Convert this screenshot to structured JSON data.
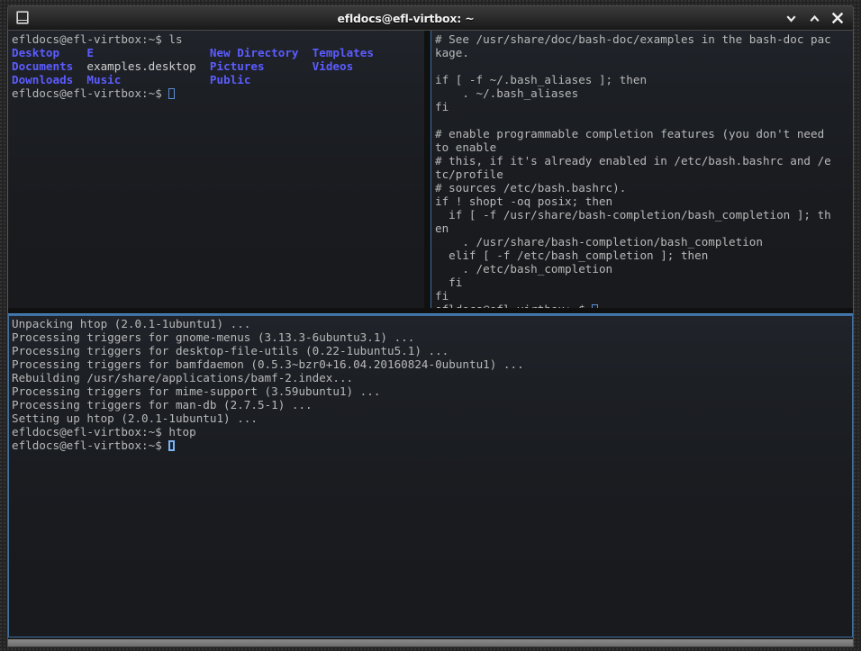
{
  "window": {
    "title": "efldocs@efl-virtbox: ~",
    "icon": "terminal-window-icon",
    "controls": [
      {
        "name": "minimize-button",
        "glyph": "chevron-down"
      },
      {
        "name": "maximize-button",
        "glyph": "chevron-up"
      },
      {
        "name": "close-button",
        "glyph": "cross"
      }
    ]
  },
  "colors": {
    "directory_blue": "#5c5cff",
    "foreground": "#c8c8c8",
    "background": "#1a1c20",
    "active_border": "#3f6f9f",
    "cursor": "#7fb4f0"
  },
  "panes": {
    "top_left": {
      "name": "pane-top-left",
      "active": false,
      "lines": [
        [
          {
            "t": "efldocs@efl-virtbox:~$ ls",
            "c": "dim"
          }
        ],
        [
          {
            "t": "Desktop",
            "c": "blue"
          },
          {
            "t": "    ",
            "c": "dim"
          },
          {
            "t": "E",
            "c": "blue"
          },
          {
            "t": "                 ",
            "c": "dim"
          },
          {
            "t": "New Directory",
            "c": "blue"
          },
          {
            "t": "  ",
            "c": "dim"
          },
          {
            "t": "Templates",
            "c": "blue"
          }
        ],
        [
          {
            "t": "Documents",
            "c": "blue"
          },
          {
            "t": "  ",
            "c": "dim"
          },
          {
            "t": "examples.desktop",
            "c": "white"
          },
          {
            "t": "  ",
            "c": "dim"
          },
          {
            "t": "Pictures",
            "c": "blue"
          },
          {
            "t": "       ",
            "c": "dim"
          },
          {
            "t": "Videos",
            "c": "blue"
          }
        ],
        [
          {
            "t": "Downloads",
            "c": "blue"
          },
          {
            "t": "  ",
            "c": "dim"
          },
          {
            "t": "Music",
            "c": "blue"
          },
          {
            "t": "             ",
            "c": "dim"
          },
          {
            "t": "Public",
            "c": "blue"
          }
        ],
        [
          {
            "t": "efldocs@efl-virtbox:~$ ",
            "c": "dim"
          },
          {
            "t": "",
            "c": "cursor-hollow"
          }
        ]
      ]
    },
    "top_right": {
      "name": "pane-top-right",
      "active": false,
      "lines": [
        [
          {
            "t": "# See /usr/share/doc/bash-doc/examples in the bash-doc pac",
            "c": "dim"
          }
        ],
        [
          {
            "t": "kage.",
            "c": "dim"
          }
        ],
        [
          {
            "t": "",
            "c": "dim"
          }
        ],
        [
          {
            "t": "if [ -f ~/.bash_aliases ]; then",
            "c": "dim"
          }
        ],
        [
          {
            "t": "    . ~/.bash_aliases",
            "c": "dim"
          }
        ],
        [
          {
            "t": "fi",
            "c": "dim"
          }
        ],
        [
          {
            "t": "",
            "c": "dim"
          }
        ],
        [
          {
            "t": "# enable programmable completion features (you don't need",
            "c": "dim"
          }
        ],
        [
          {
            "t": "to enable",
            "c": "dim"
          }
        ],
        [
          {
            "t": "# this, if it's already enabled in /etc/bash.bashrc and /e",
            "c": "dim"
          }
        ],
        [
          {
            "t": "tc/profile",
            "c": "dim"
          }
        ],
        [
          {
            "t": "# sources /etc/bash.bashrc).",
            "c": "dim"
          }
        ],
        [
          {
            "t": "if ! shopt -oq posix; then",
            "c": "dim"
          }
        ],
        [
          {
            "t": "  if [ -f /usr/share/bash-completion/bash_completion ]; th",
            "c": "dim"
          }
        ],
        [
          {
            "t": "en",
            "c": "dim"
          }
        ],
        [
          {
            "t": "    . /usr/share/bash-completion/bash_completion",
            "c": "dim"
          }
        ],
        [
          {
            "t": "  elif [ -f /etc/bash_completion ]; then",
            "c": "dim"
          }
        ],
        [
          {
            "t": "    . /etc/bash_completion",
            "c": "dim"
          }
        ],
        [
          {
            "t": "  fi",
            "c": "dim"
          }
        ],
        [
          {
            "t": "fi",
            "c": "dim"
          }
        ],
        [
          {
            "t": "efldocs@efl-virtbox:~$ ",
            "c": "dim"
          },
          {
            "t": "",
            "c": "cursor-hollow"
          }
        ]
      ]
    },
    "bottom": {
      "name": "pane-bottom",
      "active": true,
      "lines": [
        [
          {
            "t": "Unpacking htop (2.0.1-1ubuntu1) ...",
            "c": "dim"
          }
        ],
        [
          {
            "t": "Processing triggers for gnome-menus (3.13.3-6ubuntu3.1) ...",
            "c": "dim"
          }
        ],
        [
          {
            "t": "Processing triggers for desktop-file-utils (0.22-1ubuntu5.1) ...",
            "c": "dim"
          }
        ],
        [
          {
            "t": "Processing triggers for bamfdaemon (0.5.3~bzr0+16.04.20160824-0ubuntu1) ...",
            "c": "dim"
          }
        ],
        [
          {
            "t": "Rebuilding /usr/share/applications/bamf-2.index...",
            "c": "dim"
          }
        ],
        [
          {
            "t": "Processing triggers for mime-support (3.59ubuntu1) ...",
            "c": "dim"
          }
        ],
        [
          {
            "t": "Processing triggers for man-db (2.7.5-1) ...",
            "c": "dim"
          }
        ],
        [
          {
            "t": "Setting up htop (2.0.1-1ubuntu1) ...",
            "c": "dim"
          }
        ],
        [
          {
            "t": "efldocs@efl-virtbox:~$ htop",
            "c": "dim"
          }
        ],
        [
          {
            "t": "efldocs@efl-virtbox:~$ ",
            "c": "dim"
          },
          {
            "t": "",
            "c": "cursor-solid"
          }
        ]
      ]
    }
  }
}
